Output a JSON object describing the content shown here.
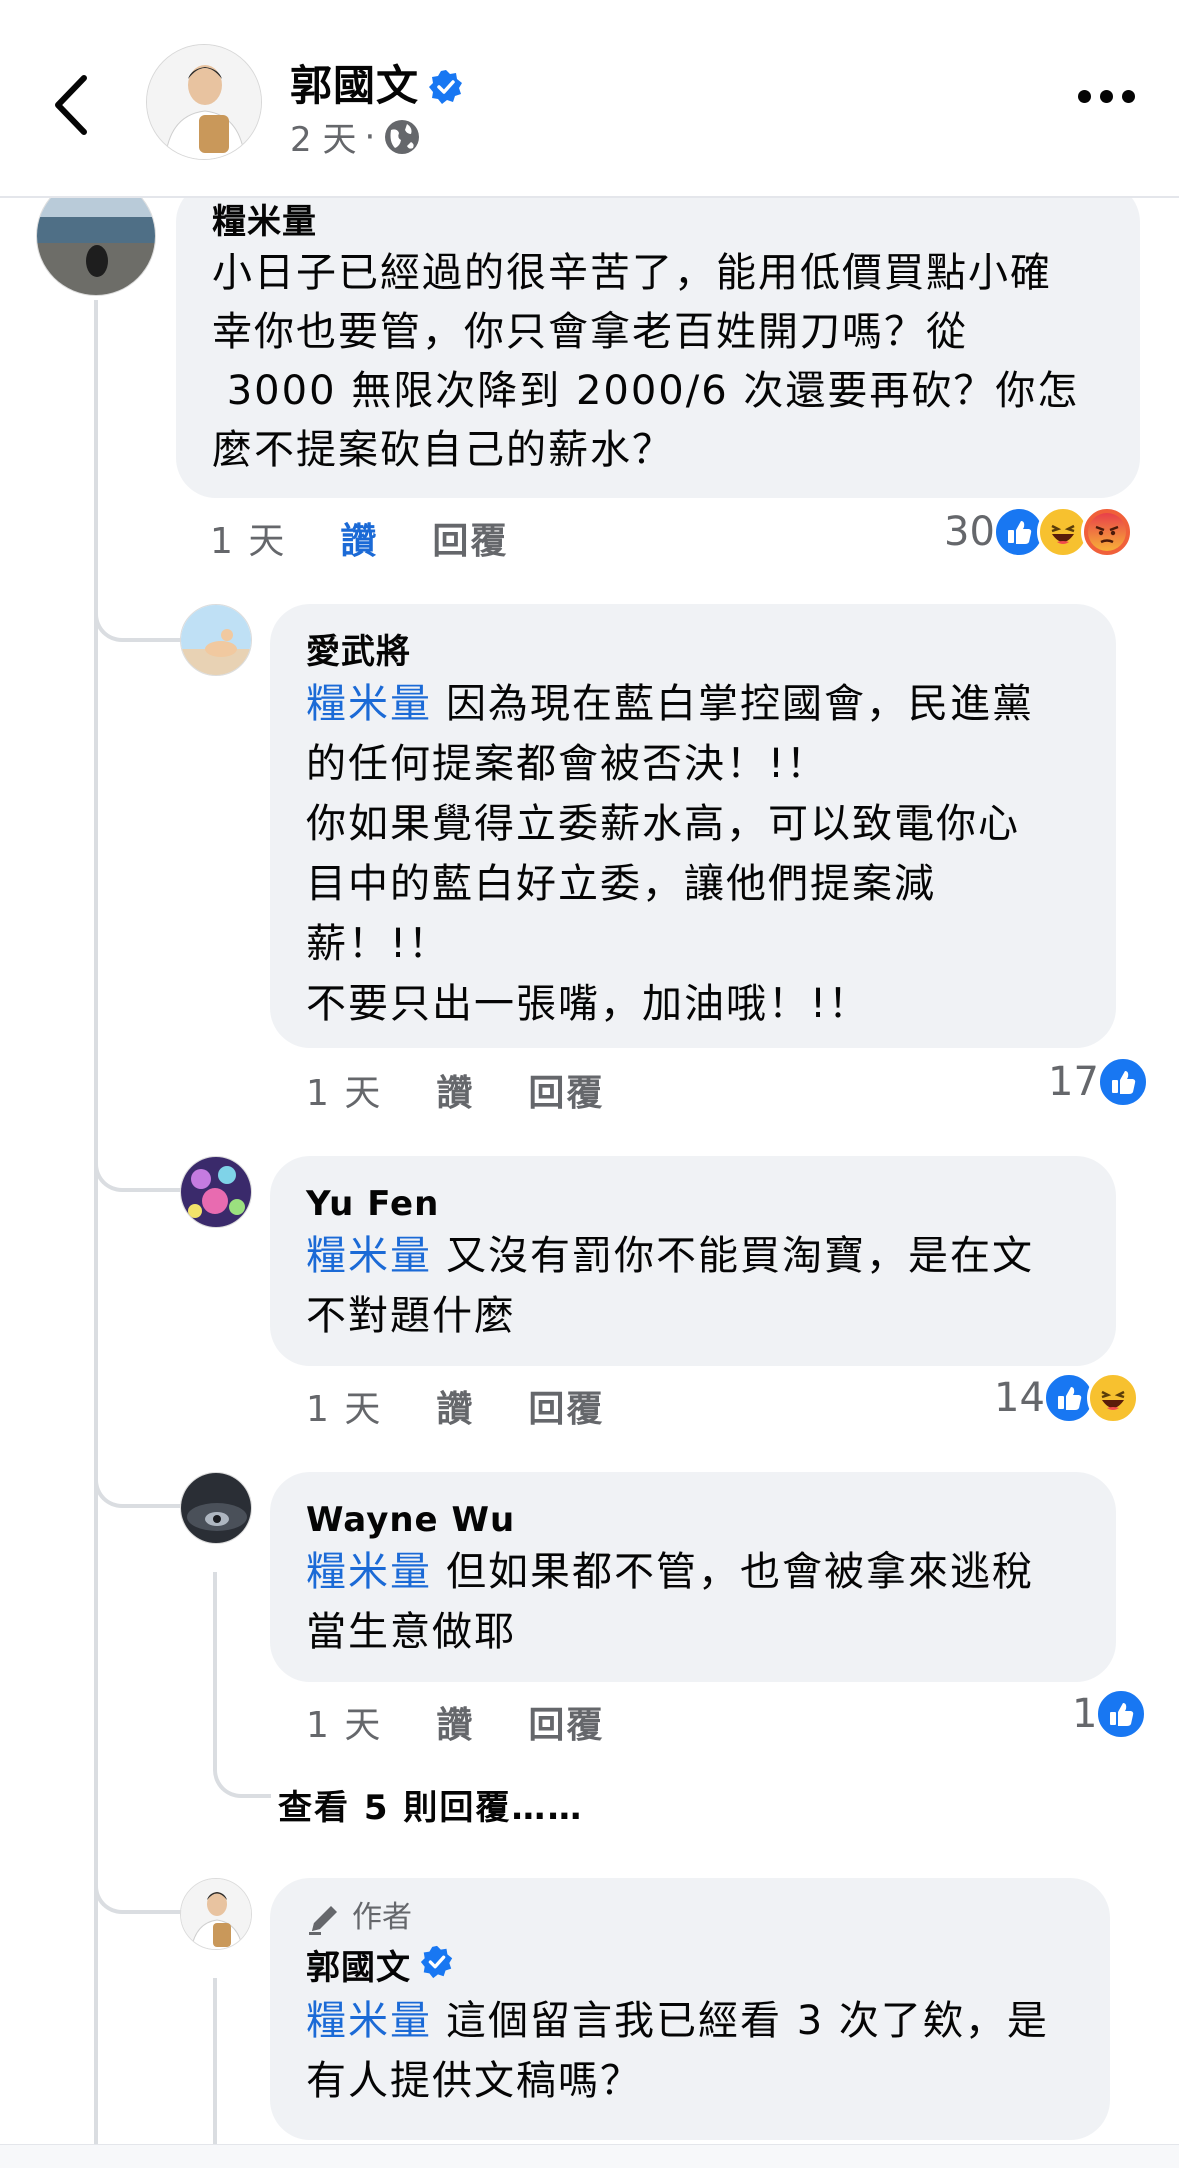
{
  "header": {
    "name": "郭國文",
    "time": "2 天",
    "separator": "·",
    "icons": {
      "back": "chevron-left-icon",
      "verified": "verified-badge-icon",
      "privacy": "globe-icon",
      "more": "more-icon"
    }
  },
  "colors": {
    "accent": "#1b6ad6",
    "bubble": "#f0f2f5",
    "muted": "#65676b",
    "like": "#1877f2",
    "angry": "#f0603a",
    "haha": "#f7c12f"
  },
  "comments": [
    {
      "name": "糧米量",
      "text": "小日子已經過的很辛苦了，能用低價買點小確\n幸你也要管，你只會拿老百姓開刀嗎？從\n 3000 無限次降到 2000/6 次還要再砍？你怎\n麼不提案砍自己的薪水？",
      "time": "1 天",
      "like": "讚",
      "reply": "回覆",
      "count": "30",
      "reactions": [
        "like",
        "haha",
        "angry"
      ]
    },
    {
      "name": "愛武將",
      "mention": "糧米量",
      "text": "因為現在藍白掌控國會，民進黨\n的任何提案都會被否決！!！\n你如果覺得立委薪水高，可以致電你心\n目中的藍白好立委，讓他們提案減\n薪！!！\n不要只出一張嘴，加油哦！!！",
      "time": "1 天",
      "like": "讚",
      "reply": "回覆",
      "count": "17",
      "reactions": [
        "like"
      ]
    },
    {
      "name": "Yu Fen",
      "mention": "糧米量",
      "text": "又沒有罰你不能買淘寶，是在文\n不對題什麼",
      "time": "1 天",
      "like": "讚",
      "reply": "回覆",
      "count": "14",
      "reactions": [
        "like",
        "haha"
      ]
    },
    {
      "name": "Wayne Wu",
      "mention": "糧米量",
      "text": "但如果都不管，也會被拿來逃稅\n當生意做耶",
      "time": "1 天",
      "like": "讚",
      "reply": "回覆",
      "count": "1",
      "reactions": [
        "like"
      ]
    },
    {
      "author_tag": "作者",
      "name": "郭國文",
      "mention": "糧米量",
      "text": "這個留言我已經看 3 次了欸，是\n有人提供文稿嗎？"
    }
  ],
  "view_more": "查看 5 則回覆……"
}
